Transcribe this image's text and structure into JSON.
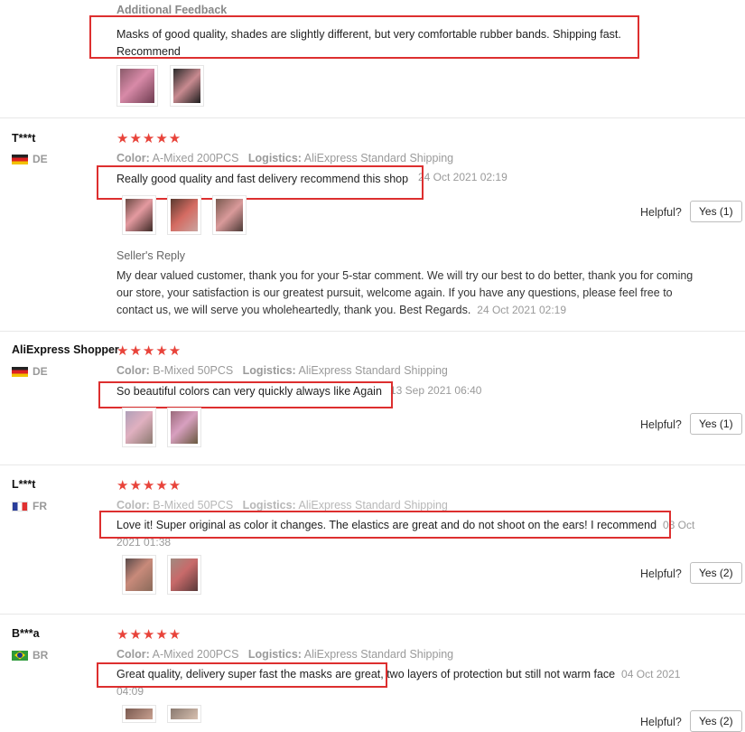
{
  "top": {
    "heading": "Additional Feedback",
    "text": "Masks of good quality, shades are slightly different, but very comfortable rubber bands. Shipping fast. Recommend"
  },
  "labels": {
    "color": "Color:",
    "logistics": "Logistics:",
    "helpful": "Helpful?",
    "seller_reply": "Seller's Reply",
    "stars": "★★★★★"
  },
  "reviews": [
    {
      "name": "T***t",
      "country": "DE",
      "color": "A-Mixed 200PCS",
      "logistics": "AliExpress Standard Shipping",
      "text": "Really good quality and fast delivery recommend this shop",
      "date": "24 Oct 2021 02:19",
      "yes": "Yes (1)",
      "reply": {
        "text": "My dear valued customer, thank you for your 5-star comment. We will try our best to do better, thank you for coming our store, your satisfaction is our greatest pursuit, welcome again. If you have any questions, please feel free to contact us, we will serve you wholeheartedly, thank you. Best Regards.",
        "date": "24 Oct 2021 02:19"
      }
    },
    {
      "name": "AliExpress Shopper",
      "country": "DE",
      "color": "B-Mixed 50PCS",
      "logistics": "AliExpress Standard Shipping",
      "text": "So beautiful colors can very quickly always like Again",
      "date": "13 Sep 2021 06:40",
      "yes": "Yes (1)"
    },
    {
      "name": "L***t",
      "country": "FR",
      "color": "B-Mixed 50PCS",
      "logistics": "AliExpress Standard Shipping",
      "text": "Love it! Super original as color it changes. The elastics are great and do not shoot on the ears! I recommend",
      "date": "08 Oct 2021 01:38",
      "yes": "Yes (2)"
    },
    {
      "name": "B***a",
      "country": "BR",
      "color": "A-Mixed 200PCS",
      "logistics": "AliExpress Standard Shipping",
      "text": "Great quality, delivery super fast the masks are great, two layers of protection but still not warm face",
      "date": "04 Oct 2021 04:09",
      "yes": "Yes (2)"
    }
  ],
  "colors": {
    "highlight_box": "#dd2f2f",
    "stars": "#e8433a",
    "separator": "#e8e8e8"
  }
}
